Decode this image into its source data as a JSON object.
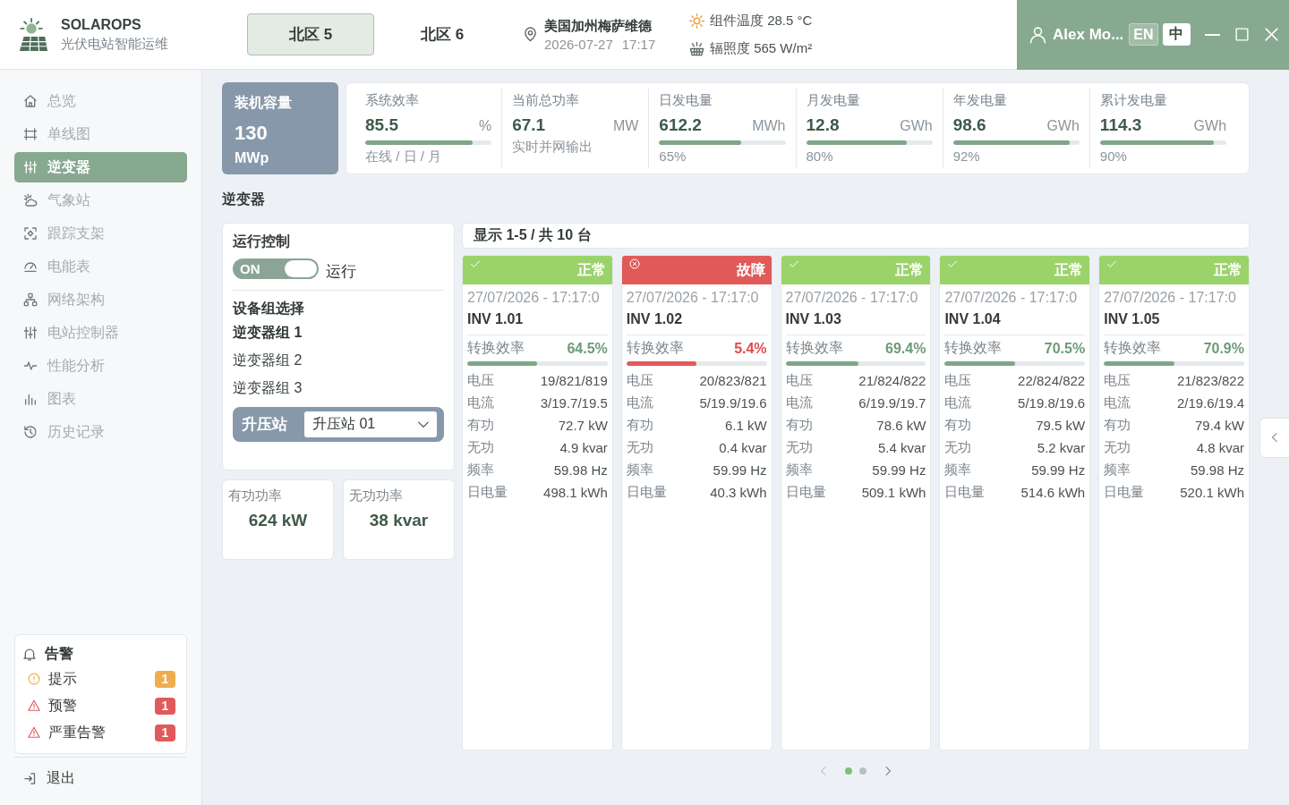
{
  "header": {
    "brand": {
      "title": "SOLAROPS",
      "subtitle": "光伏电站智能运维"
    },
    "zones": [
      {
        "label": "北区 5",
        "selected": true
      },
      {
        "label": "北区 6",
        "selected": false
      }
    ],
    "location": {
      "name": "美国加州梅萨维德",
      "date": "2026-07-27",
      "time": "17:17"
    },
    "weather": [
      {
        "kind": "temperature",
        "text": "组件温度 28.5 °C"
      },
      {
        "kind": "irradiance",
        "text": "辐照度 565 W/m²"
      }
    ],
    "user": {
      "name": "Alex Mo..."
    },
    "languages": [
      {
        "label": "EN",
        "selected": false
      },
      {
        "label": "中",
        "selected": true
      }
    ]
  },
  "sidebar": {
    "nav": [
      {
        "label": "总览",
        "selected": false
      },
      {
        "label": "单线图",
        "selected": false
      },
      {
        "label": "逆变器",
        "selected": true
      },
      {
        "label": "气象站",
        "selected": false
      },
      {
        "label": "跟踪支架",
        "selected": false
      },
      {
        "label": "电能表",
        "selected": false
      },
      {
        "label": "网络架构",
        "selected": false
      },
      {
        "label": "电站控制器",
        "selected": false
      },
      {
        "label": "性能分析",
        "selected": false
      },
      {
        "label": "图表",
        "selected": false
      },
      {
        "label": "历史记录",
        "selected": false
      }
    ],
    "alerts": {
      "title": "告警",
      "items": [
        {
          "kind": "info",
          "label": "提示",
          "count": "1",
          "color": "#f0ad4e"
        },
        {
          "kind": "warning",
          "label": "预警",
          "count": "1",
          "color": "#e05a5a"
        },
        {
          "kind": "critical",
          "label": "严重告警",
          "count": "1",
          "color": "#e05a5a"
        }
      ]
    },
    "logout": "退出"
  },
  "summary": {
    "capacity": {
      "label": "装机容量",
      "value": "130",
      "unit": "MWp"
    },
    "metrics": [
      {
        "label": "系统效率",
        "value": "85.5",
        "unit": "%",
        "level": 0.85,
        "note": "在线 / 日 / 月"
      },
      {
        "label": "当前总功率",
        "value": "67.1",
        "unit": "MW",
        "note": "实时并网输出"
      },
      {
        "label": "日发电量",
        "value": "612.2",
        "unit": "MWh",
        "level": 0.65,
        "note": "65%"
      },
      {
        "label": "月发电量",
        "value": "12.8",
        "unit": "GWh",
        "level": 0.8,
        "note": "80%"
      },
      {
        "label": "年发电量",
        "value": "98.6",
        "unit": "GWh",
        "level": 0.92,
        "note": "92%"
      },
      {
        "label": "累计发电量",
        "value": "114.3",
        "unit": "GWh",
        "level": 0.9,
        "note": "90%"
      }
    ]
  },
  "section_title": "逆变器",
  "control": {
    "title": "运行控制",
    "switch": {
      "label": "ON",
      "on": true
    },
    "status": "运行",
    "group_title": "设备组选择",
    "groups": [
      {
        "label": "逆变器组 1",
        "selected": true
      },
      {
        "label": "逆变器组 2",
        "selected": false
      },
      {
        "label": "逆变器组 3",
        "selected": false
      }
    ],
    "substation": {
      "label": "升压站",
      "value": "升压站 01"
    }
  },
  "totals": [
    {
      "label": "有功功率",
      "value": "624 kW"
    },
    {
      "label": "无功功率",
      "value": "38 kvar"
    }
  ],
  "inverters": {
    "summary": "显示 1-5 / 共 10 台",
    "cards": [
      {
        "kind": "normal",
        "status": "正常",
        "timestamp": "27/07/2026 - 17:17:0",
        "name": "INV 1.01",
        "efficiency_label": "转换效率",
        "efficiency": "64.5%",
        "level": 0.5,
        "readings": [
          {
            "label": "电压",
            "value": "19/821/819"
          },
          {
            "label": "电流",
            "value": "3/19.7/19.5"
          },
          {
            "label": "有功",
            "value": "72.7 kW"
          },
          {
            "label": "无功",
            "value": "4.9 kvar"
          },
          {
            "label": "频率",
            "value": "59.98 Hz"
          },
          {
            "label": "日电量",
            "value": "498.1 kWh"
          }
        ]
      },
      {
        "kind": "fault",
        "status": "故障",
        "timestamp": "27/07/2026 - 17:17:0",
        "name": "INV 1.02",
        "efficiency_label": "转换效率",
        "efficiency": "5.4%",
        "level": 0.5,
        "readings": [
          {
            "label": "电压",
            "value": "20/823/821"
          },
          {
            "label": "电流",
            "value": "5/19.9/19.6"
          },
          {
            "label": "有功",
            "value": "6.1 kW"
          },
          {
            "label": "无功",
            "value": "0.4 kvar"
          },
          {
            "label": "频率",
            "value": "59.99 Hz"
          },
          {
            "label": "日电量",
            "value": "40.3 kWh"
          }
        ]
      },
      {
        "kind": "normal",
        "status": "正常",
        "timestamp": "27/07/2026 - 17:17:0",
        "name": "INV 1.03",
        "efficiency_label": "转换效率",
        "efficiency": "69.4%",
        "level": 0.52,
        "readings": [
          {
            "label": "电压",
            "value": "21/824/822"
          },
          {
            "label": "电流",
            "value": "6/19.9/19.7"
          },
          {
            "label": "有功",
            "value": "78.6 kW"
          },
          {
            "label": "无功",
            "value": "5.4 kvar"
          },
          {
            "label": "频率",
            "value": "59.99 Hz"
          },
          {
            "label": "日电量",
            "value": "509.1 kWh"
          }
        ]
      },
      {
        "kind": "normal",
        "status": "正常",
        "timestamp": "27/07/2026 - 17:17:0",
        "name": "INV 1.04",
        "efficiency_label": "转换效率",
        "efficiency": "70.5%",
        "level": 0.5,
        "readings": [
          {
            "label": "电压",
            "value": "22/824/822"
          },
          {
            "label": "电流",
            "value": "5/19.8/19.6"
          },
          {
            "label": "有功",
            "value": "79.5 kW"
          },
          {
            "label": "无功",
            "value": "5.2 kvar"
          },
          {
            "label": "频率",
            "value": "59.99 Hz"
          },
          {
            "label": "日电量",
            "value": "514.6 kWh"
          }
        ]
      },
      {
        "kind": "normal",
        "status": "正常",
        "timestamp": "27/07/2026 - 17:17:0",
        "name": "INV 1.05",
        "efficiency_label": "转换效率",
        "efficiency": "70.9%",
        "level": 0.5,
        "readings": [
          {
            "label": "电压",
            "value": "21/823/822"
          },
          {
            "label": "电流",
            "value": "2/19.6/19.4"
          },
          {
            "label": "有功",
            "value": "79.4 kW"
          },
          {
            "label": "无功",
            "value": "4.8 kvar"
          },
          {
            "label": "频率",
            "value": "59.98 Hz"
          },
          {
            "label": "日电量",
            "value": "520.1 kWh"
          }
        ]
      }
    ]
  },
  "pagination": {
    "previous": {
      "disabled": true
    },
    "pages": [
      {
        "selected": true
      },
      {
        "selected": false
      }
    ],
    "next": {
      "disabled": false
    }
  }
}
